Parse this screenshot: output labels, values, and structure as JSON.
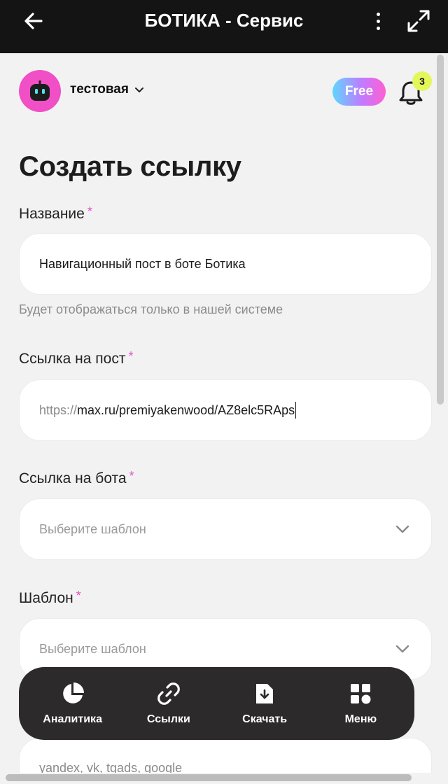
{
  "window": {
    "title": "БОТИКА - Сервис"
  },
  "header": {
    "workspace_name": "тестовая",
    "plan_badge": "Free",
    "notifications_count": "3"
  },
  "page": {
    "title": "Создать ссылку"
  },
  "form": {
    "required_mark": "*",
    "name": {
      "label": "Название",
      "value": "Навигационный пост в боте Ботика",
      "hint": "Будет отображаться только в нашей системе"
    },
    "post_link": {
      "label": "Ссылка на пост",
      "value_prefix": "https://",
      "value_rest": "max.ru/premiyakenwood/AZ8elc5RAps"
    },
    "bot_link": {
      "label": "Ссылка на бота",
      "placeholder": "Выберите шаблон"
    },
    "template": {
      "label": "Шаблон",
      "placeholder": "Выберите шаблон"
    },
    "partial_field_value": "yandex, vk, tgads, google"
  },
  "bottom_nav": {
    "items": [
      {
        "label": "Аналитика",
        "icon": "pie-chart-icon"
      },
      {
        "label": "Ссылки",
        "icon": "link-icon"
      },
      {
        "label": "Скачать",
        "icon": "download-file-icon"
      },
      {
        "label": "Меню",
        "icon": "grid-menu-icon"
      }
    ]
  },
  "colors": {
    "topbar_bg": "#141414",
    "accent_pink": "#e64fc8",
    "avatar_bg": "#f04fc6",
    "badge_yellow": "#e3f75a",
    "nav_bg": "#2d2a2b"
  }
}
